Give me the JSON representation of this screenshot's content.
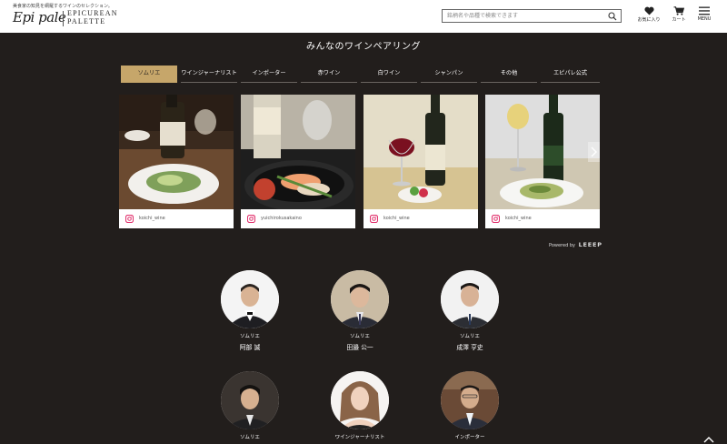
{
  "header": {
    "tagline": "美食家の知見を網羅するワインのセレクション。",
    "logo_script": "Epi pale",
    "logo_line1": "EPICUREAN",
    "logo_line2": "PALETTE",
    "search_placeholder": "銘柄名や品種で検索できます",
    "favorites_label": "お気に入り",
    "cart_label": "カート",
    "menu_label": "MENU"
  },
  "section": {
    "title": "みんなのワインペアリング",
    "tabs": [
      {
        "label": "ソムリエ",
        "active": true
      },
      {
        "label": "ワインジャーナリスト",
        "active": false
      },
      {
        "label": "インポーター",
        "active": false
      },
      {
        "label": "赤ワイン",
        "active": false
      },
      {
        "label": "白ワイン",
        "active": false
      },
      {
        "label": "シャンパン",
        "active": false
      },
      {
        "label": "その他",
        "active": false
      },
      {
        "label": "エピパレ公式",
        "active": false
      }
    ],
    "cards": [
      {
        "handle": "koichi_wine"
      },
      {
        "handle": "yuichirokusakaino"
      },
      {
        "handle": "koichi_wine"
      },
      {
        "handle": "koichi_wine"
      }
    ],
    "powered_by": "Powered by",
    "powered_brand": "LEEEP"
  },
  "people": [
    {
      "role": "ソムリエ",
      "name": "阿部 誠"
    },
    {
      "role": "ソムリエ",
      "name": "田邉 公一"
    },
    {
      "role": "ソムリエ",
      "name": "成澤 亨史"
    },
    {
      "role": "ソムリエ",
      "name": ""
    },
    {
      "role": "ワインジャーナリスト",
      "name": ""
    },
    {
      "role": "インポーター",
      "name": ""
    }
  ],
  "colors": {
    "background": "#221e1c",
    "active_tab": "#c6a66a",
    "header_bg": "#ffffff"
  }
}
